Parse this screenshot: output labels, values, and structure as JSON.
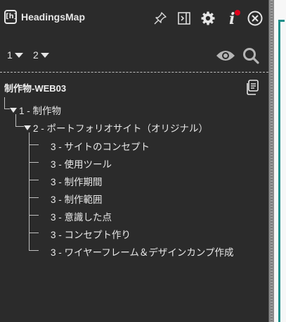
{
  "app": {
    "name": "HeadingsMap",
    "logo_text": "[h]"
  },
  "toolbar": {
    "icons": [
      "pin-icon",
      "toggle-panel-icon",
      "gear-icon",
      "info-icon",
      "close-icon"
    ],
    "info_badge_color": "#e0001b"
  },
  "levels": {
    "items": [
      "1",
      "2"
    ]
  },
  "view_icons": [
    "eye-icon",
    "search-icon"
  ],
  "document": {
    "title": "制作物-WEB03",
    "copy_icon": "copy-icon"
  },
  "tree": {
    "h1": {
      "label": "1 - 制作物"
    },
    "h2": {
      "label": "2 - ポートフォリオサイト（オリジナル）"
    },
    "h3": [
      {
        "label": "3 - サイトのコンセプト"
      },
      {
        "label": "3 - 使用ツール"
      },
      {
        "label": "3 - 制作期間"
      },
      {
        "label": "3 - 制作範囲"
      },
      {
        "label": "3 - 意識した点"
      },
      {
        "label": "3 - コンセプト作り"
      },
      {
        "label": "3 - ワイヤーフレーム＆デザインカンプ作成"
      }
    ]
  },
  "colors": {
    "panel_bg": "#2b2b2b",
    "text": "#e6e6e6",
    "accent_edge": "#1f8f8a"
  }
}
